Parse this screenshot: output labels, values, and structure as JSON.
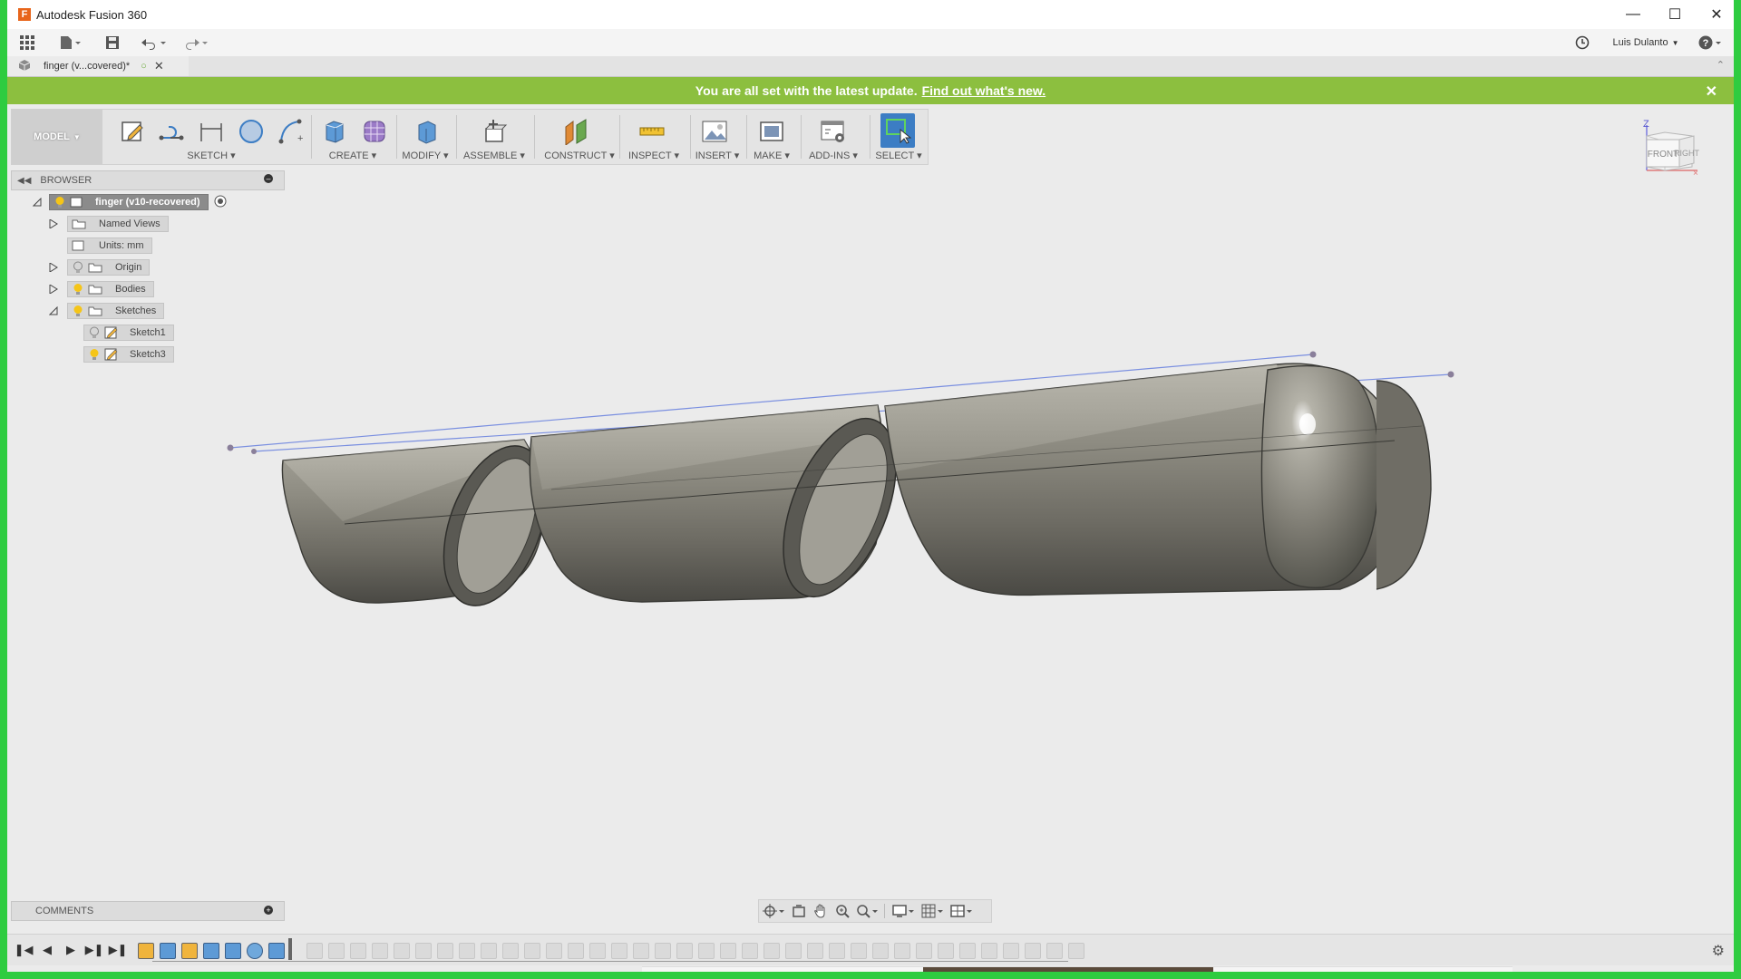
{
  "window": {
    "title": "Autodesk Fusion 360",
    "app_logo": "F"
  },
  "qat": {
    "user_name": "Luis Dulanto"
  },
  "tab": {
    "label": "finger (v...covered)*"
  },
  "banner": {
    "message": "You are all set with the latest update.",
    "link": "Find out what's new."
  },
  "ribbon": {
    "workspace": "MODEL",
    "groups": [
      {
        "label": "SKETCH"
      },
      {
        "label": "CREATE"
      },
      {
        "label": "MODIFY"
      },
      {
        "label": "ASSEMBLE"
      },
      {
        "label": "CONSTRUCT"
      },
      {
        "label": "INSPECT"
      },
      {
        "label": "INSERT"
      },
      {
        "label": "MAKE"
      },
      {
        "label": "ADD-INS"
      },
      {
        "label": "SELECT"
      }
    ]
  },
  "browser": {
    "header": "BROWSER",
    "root": "finger (v10-recovered)",
    "items": [
      {
        "label": "Named Views"
      },
      {
        "label": "Units: mm"
      },
      {
        "label": "Origin"
      },
      {
        "label": "Bodies"
      },
      {
        "label": "Sketches"
      },
      {
        "label": "Sketch1"
      },
      {
        "label": "Sketch3"
      }
    ]
  },
  "viewcube": {
    "front": "FRONT",
    "right": "RIGHT",
    "axis_z": "Z"
  },
  "comments": {
    "header": "COMMENTS"
  },
  "colors": {
    "banner": "#8cbf3f",
    "select_accent": "#3c7dc4",
    "model_body": "#8c8a80",
    "window_border": "#2ecc40"
  }
}
